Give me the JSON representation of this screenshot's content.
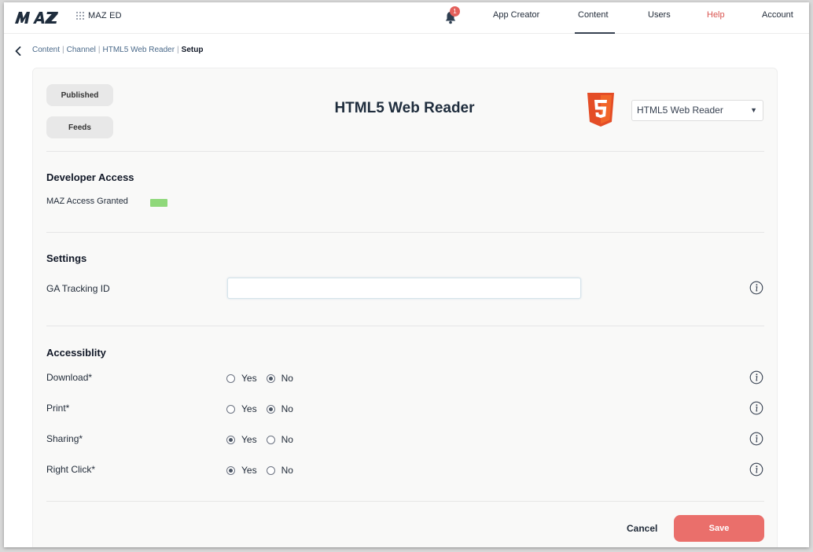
{
  "brand": {
    "logo_text": "MAZ",
    "sub_label": "MAZ ED"
  },
  "nav": {
    "notification_count": "1",
    "items": [
      {
        "label": "App Creator"
      },
      {
        "label": "Content"
      },
      {
        "label": "Users"
      },
      {
        "label": "Help"
      },
      {
        "label": "Account"
      }
    ],
    "active": "Content"
  },
  "breadcrumb": {
    "items": [
      {
        "label": "Content"
      },
      {
        "label": "Channel"
      },
      {
        "label": "HTML5 Web Reader"
      }
    ],
    "separator": "|",
    "current": "Setup"
  },
  "side_buttons": {
    "published": "Published",
    "feeds": "Feeds"
  },
  "page_title": "HTML5 Web Reader",
  "channel_select": {
    "value": "HTML5 Web Reader",
    "arrow": "▼"
  },
  "developer_access": {
    "title": "Developer Access",
    "label": "MAZ Access Granted",
    "status_color": "#8fd87a"
  },
  "settings": {
    "title": "Settings",
    "ga_label": "GA Tracking ID",
    "ga_value": ""
  },
  "accessibility": {
    "title": "Accessiblity",
    "yes_label": "Yes",
    "no_label": "No",
    "rows": [
      {
        "label": "Download*",
        "value": "No"
      },
      {
        "label": "Print*",
        "value": "No"
      },
      {
        "label": "Sharing*",
        "value": "Yes"
      },
      {
        "label": "Right Click*",
        "value": "Yes"
      }
    ]
  },
  "actions": {
    "cancel": "Cancel",
    "save": "Save"
  },
  "colors": {
    "accent": "#ea6f6b",
    "help": "#d9534f",
    "badge": "#e3605c",
    "html5": "#e44d26"
  },
  "icons": [
    "maz-logo",
    "grid-icon",
    "bell-icon",
    "back-arrow-icon",
    "html5-logo",
    "chevron-down-icon",
    "info-icon"
  ]
}
